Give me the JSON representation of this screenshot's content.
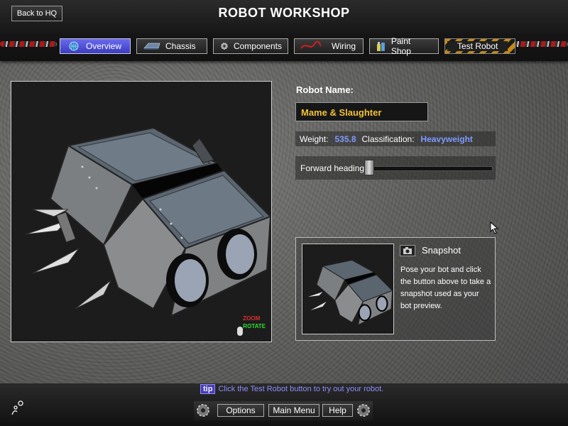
{
  "header": {
    "back_label": "Back to HQ",
    "title": "ROBOT WORKSHOP"
  },
  "tabs": [
    {
      "label": "Overview",
      "icon": "globe-icon",
      "active": true
    },
    {
      "label": "Chassis",
      "icon": "chassis-icon",
      "active": false
    },
    {
      "label": "Components",
      "icon": "gear-icon",
      "active": false
    },
    {
      "label": "Wiring",
      "icon": "wire-icon",
      "active": false
    },
    {
      "label": "Paint Shop",
      "icon": "paint-cans-icon",
      "active": false
    },
    {
      "label": "Test Robot",
      "icon": "",
      "active": false
    }
  ],
  "viewport": {
    "zoom_label": "ZOOM",
    "rotate_label": "ROTATE"
  },
  "robot": {
    "name_label": "Robot Name:",
    "name_value": "Mame & Slaughter",
    "weight_label": "Weight:",
    "weight_value": "535.8",
    "class_label": "Classification:",
    "class_value": "Heavyweight",
    "heading_label": "Forward heading:",
    "heading_value": 0
  },
  "snapshot": {
    "title": "Snapshot",
    "description": "Pose your bot and click the button above to take a snapshot used as your bot preview."
  },
  "footer": {
    "tip_badge": "tip",
    "tip_text": "Click the Test Robot button to try out your robot.",
    "options_label": "Options",
    "main_menu_label": "Main Menu",
    "help_label": "Help"
  },
  "colors": {
    "accent_active_tab": "#5a5ae6",
    "name_text": "#f2c03c",
    "stat_value": "#7f9aff",
    "tip_text": "#8d8dff"
  }
}
